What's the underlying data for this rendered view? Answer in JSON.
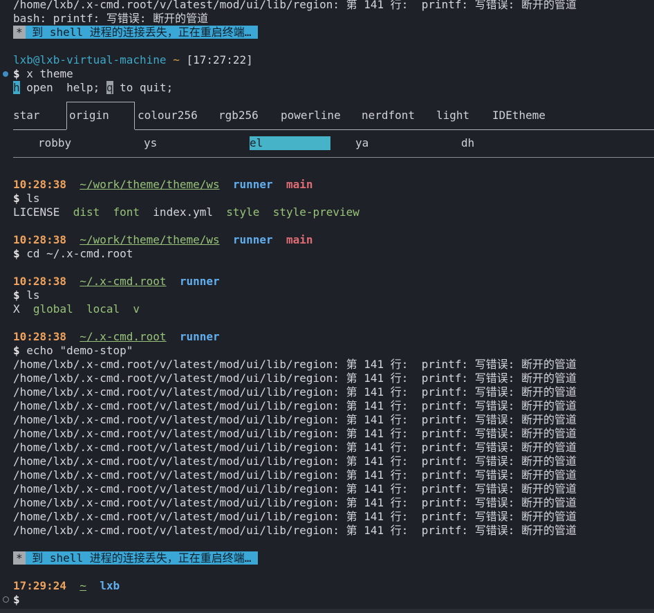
{
  "top_error": "/home/lxb/.x-cmd.root/v/latest/mod/ui/lib/region: 第 141 行:  printf: 写错误: 断开的管道",
  "bash_error": "bash: printf: 写错误: 断开的管道",
  "notice": {
    "star": "*",
    "text": " 到 shell 进程的连接丢失，正在重启终端… "
  },
  "prompt1": {
    "user": "lxb@lxb-virtual-machine",
    "tilde": "~",
    "time": "[17:27:22]"
  },
  "command1": "x theme",
  "help_line": {
    "h_key": "h",
    "h_text": " open  help; ",
    "q_key": "q",
    "q_text": " to quit;"
  },
  "tabs": [
    {
      "label": "star"
    },
    {
      "label": "origin"
    },
    {
      "label": "colour256"
    },
    {
      "label": "rgb256"
    },
    {
      "label": "powerline"
    },
    {
      "label": "nerdfont"
    },
    {
      "label": "light"
    },
    {
      "label": "IDEtheme"
    }
  ],
  "subtabs": [
    {
      "label": "robby"
    },
    {
      "label": "ys"
    },
    {
      "label": "el"
    },
    {
      "label": "ya"
    },
    {
      "label": "dh"
    }
  ],
  "blocks": [
    {
      "time": "10:28:38",
      "path": "~/work/theme/theme/ws",
      "user": "runner",
      "branch": "main",
      "command": "ls",
      "ls": [
        "LICENSE",
        "dist",
        "font",
        "index.yml",
        "style",
        "style-preview"
      ]
    },
    {
      "time": "10:28:38",
      "path": "~/work/theme/theme/ws",
      "user": "runner",
      "branch": "main",
      "command": "cd ~/.x-cmd.root"
    },
    {
      "time": "10:28:38",
      "path": "~/.x-cmd.root",
      "user": "runner",
      "command": "ls",
      "ls": [
        "X",
        "global",
        "local",
        "v"
      ]
    },
    {
      "time": "10:28:38",
      "path": "~/.x-cmd.root",
      "user": "runner",
      "command": "echo \"demo-stop\""
    }
  ],
  "error_lines": [
    "/home/lxb/.x-cmd.root/v/latest/mod/ui/lib/region: 第 141 行:  printf: 写错误: 断开的管道",
    "/home/lxb/.x-cmd.root/v/latest/mod/ui/lib/region: 第 141 行:  printf: 写错误: 断开的管道",
    "/home/lxb/.x-cmd.root/v/latest/mod/ui/lib/region: 第 141 行:  printf: 写错误: 断开的管道",
    "/home/lxb/.x-cmd.root/v/latest/mod/ui/lib/region: 第 141 行:  printf: 写错误: 断开的管道",
    "/home/lxb/.x-cmd.root/v/latest/mod/ui/lib/region: 第 141 行:  printf: 写错误: 断开的管道",
    "/home/lxb/.x-cmd.root/v/latest/mod/ui/lib/region: 第 141 行:  printf: 写错误: 断开的管道",
    "/home/lxb/.x-cmd.root/v/latest/mod/ui/lib/region: 第 141 行:  printf: 写错误: 断开的管道",
    "/home/lxb/.x-cmd.root/v/latest/mod/ui/lib/region: 第 141 行:  printf: 写错误: 断开的管道",
    "/home/lxb/.x-cmd.root/v/latest/mod/ui/lib/region: 第 141 行:  printf: 写错误: 断开的管道",
    "/home/lxb/.x-cmd.root/v/latest/mod/ui/lib/region: 第 141 行:  printf: 写错误: 断开的管道",
    "/home/lxb/.x-cmd.root/v/latest/mod/ui/lib/region: 第 141 行:  printf: 写错误: 断开的管道",
    "/home/lxb/.x-cmd.root/v/latest/mod/ui/lib/region: 第 141 行:  printf: 写错误: 断开的管道",
    "/home/lxb/.x-cmd.root/v/latest/mod/ui/lib/region: 第 141 行:  printf: 写错误: 断开的管道"
  ],
  "final_prompt": {
    "time": "17:29:24",
    "path": "~",
    "user": "lxb",
    "dollar": "$"
  },
  "dollar": "$",
  "colors": {
    "background": "#1e2127",
    "notice_bg": "#3aa7d6",
    "time": "#f0a35e",
    "path": "#98c379",
    "user": "#61afef",
    "branch": "#e06c75",
    "selected_subtab": "#46b3c8"
  }
}
